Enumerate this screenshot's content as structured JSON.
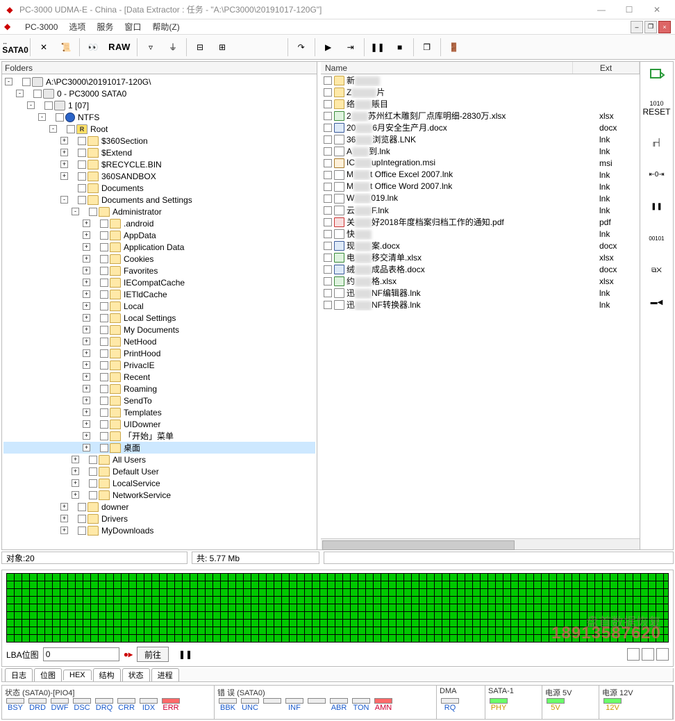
{
  "window": {
    "title": "PC-3000 UDMA-E - China - [Data Extractor : 任务 - \"A:\\PC3000\\20191017-120G\"]"
  },
  "menu": {
    "app": "PC-3000",
    "items": [
      "选项",
      "服务",
      "窗口",
      "帮助(Z)"
    ]
  },
  "toolbar": {
    "sata": "SATA0",
    "raw": "RAW"
  },
  "folders_header": "Folders",
  "tree": [
    {
      "d": 0,
      "exp": "-",
      "cb": false,
      "ico": "drive",
      "label": "A:\\PC3000\\20191017-120G\\"
    },
    {
      "d": 1,
      "exp": "-",
      "cb": true,
      "ico": "drive",
      "label": "0 - PC3000 SATA0"
    },
    {
      "d": 2,
      "exp": "-",
      "cb": true,
      "ico": "drive",
      "label": "1 [07]"
    },
    {
      "d": 3,
      "exp": "-",
      "cb": true,
      "ico": "ntfs",
      "label": "NTFS"
    },
    {
      "d": 4,
      "exp": "-",
      "cb": true,
      "ico": "root",
      "label": "Root",
      "rootText": "R"
    },
    {
      "d": 5,
      "exp": "+",
      "cb": true,
      "ico": "folder",
      "label": "$360Section"
    },
    {
      "d": 5,
      "exp": "+",
      "cb": true,
      "ico": "folder",
      "label": "$Extend"
    },
    {
      "d": 5,
      "exp": "+",
      "cb": true,
      "ico": "folder",
      "label": "$RECYCLE.BIN"
    },
    {
      "d": 5,
      "exp": "+",
      "cb": true,
      "ico": "folder",
      "label": "360SANDBOX"
    },
    {
      "d": 5,
      "exp": "",
      "cb": true,
      "ico": "folder",
      "label": "Documents"
    },
    {
      "d": 5,
      "exp": "-",
      "cb": true,
      "ico": "folder",
      "label": "Documents and Settings"
    },
    {
      "d": 6,
      "exp": "-",
      "cb": true,
      "ico": "folder",
      "label": "Administrator"
    },
    {
      "d": 7,
      "exp": "+",
      "cb": true,
      "ico": "folder",
      "label": ".android"
    },
    {
      "d": 7,
      "exp": "+",
      "cb": true,
      "ico": "folder",
      "label": "AppData"
    },
    {
      "d": 7,
      "exp": "+",
      "cb": true,
      "ico": "folder",
      "label": "Application Data"
    },
    {
      "d": 7,
      "exp": "+",
      "cb": true,
      "ico": "folder",
      "label": "Cookies"
    },
    {
      "d": 7,
      "exp": "+",
      "cb": true,
      "ico": "folder",
      "label": "Favorites"
    },
    {
      "d": 7,
      "exp": "+",
      "cb": true,
      "ico": "folder",
      "label": "IECompatCache"
    },
    {
      "d": 7,
      "exp": "+",
      "cb": true,
      "ico": "folder",
      "label": "IETldCache"
    },
    {
      "d": 7,
      "exp": "+",
      "cb": true,
      "ico": "folder",
      "label": "Local"
    },
    {
      "d": 7,
      "exp": "+",
      "cb": true,
      "ico": "folder",
      "label": "Local Settings"
    },
    {
      "d": 7,
      "exp": "+",
      "cb": true,
      "ico": "folder",
      "label": "My Documents"
    },
    {
      "d": 7,
      "exp": "+",
      "cb": true,
      "ico": "folder",
      "label": "NetHood"
    },
    {
      "d": 7,
      "exp": "+",
      "cb": true,
      "ico": "folder",
      "label": "PrintHood"
    },
    {
      "d": 7,
      "exp": "+",
      "cb": true,
      "ico": "folder",
      "label": "PrivacIE"
    },
    {
      "d": 7,
      "exp": "+",
      "cb": true,
      "ico": "folder",
      "label": "Recent"
    },
    {
      "d": 7,
      "exp": "+",
      "cb": true,
      "ico": "folder",
      "label": "Roaming"
    },
    {
      "d": 7,
      "exp": "+",
      "cb": true,
      "ico": "folder",
      "label": "SendTo"
    },
    {
      "d": 7,
      "exp": "+",
      "cb": true,
      "ico": "folder",
      "label": "Templates"
    },
    {
      "d": 7,
      "exp": "+",
      "cb": true,
      "ico": "folder",
      "label": "UIDowner"
    },
    {
      "d": 7,
      "exp": "+",
      "cb": true,
      "ico": "folder",
      "label": "「开始」菜单"
    },
    {
      "d": 7,
      "exp": "+",
      "cb": true,
      "ico": "folder",
      "label": "桌面",
      "selected": true
    },
    {
      "d": 6,
      "exp": "+",
      "cb": true,
      "ico": "folder",
      "label": "All Users"
    },
    {
      "d": 6,
      "exp": "+",
      "cb": true,
      "ico": "folder",
      "label": "Default User"
    },
    {
      "d": 6,
      "exp": "+",
      "cb": true,
      "ico": "folder",
      "label": "LocalService"
    },
    {
      "d": 6,
      "exp": "+",
      "cb": true,
      "ico": "folder",
      "label": "NetworkService"
    },
    {
      "d": 5,
      "exp": "+",
      "cb": true,
      "ico": "folder",
      "label": "downer"
    },
    {
      "d": 5,
      "exp": "+",
      "cb": true,
      "ico": "folder",
      "label": "Drivers"
    },
    {
      "d": 5,
      "exp": "+",
      "cb": true,
      "ico": "folder",
      "label": "MyDownloads"
    }
  ],
  "files_header": {
    "name": "Name",
    "ext": "Ext"
  },
  "files": [
    {
      "ico": "folder",
      "pre": "新",
      "blur": "xxxxxx",
      "post": "",
      "ext": ""
    },
    {
      "ico": "folder",
      "pre": "Z",
      "blur": "xxxxxx",
      "post": "片",
      "ext": ""
    },
    {
      "ico": "folder",
      "pre": "络",
      "blur": "xxxx",
      "post": "賬目",
      "ext": ""
    },
    {
      "ico": "xlsx",
      "pre": "2",
      "blur": "xxxx",
      "post": "苏州红木雕刻厂点库明细-2830万.xlsx",
      "ext": "xlsx"
    },
    {
      "ico": "docx",
      "pre": "20",
      "blur": "xxxx",
      "post": "6月安全生产月.docx",
      "ext": "docx"
    },
    {
      "ico": "lnk",
      "pre": "36",
      "blur": "xxxx",
      "post": "浏览器.LNK",
      "ext": "lnk"
    },
    {
      "ico": "lnk",
      "pre": "A",
      "blur": "xxxx",
      "post": "到.lnk",
      "ext": "lnk"
    },
    {
      "ico": "msi",
      "pre": "IC",
      "blur": "xxxx",
      "post": "upIntegration.msi",
      "ext": "msi"
    },
    {
      "ico": "lnk",
      "pre": "M",
      "blur": "xxxx",
      "post": "t Office Excel 2007.lnk",
      "ext": "lnk"
    },
    {
      "ico": "lnk",
      "pre": "M",
      "blur": "xxxx",
      "post": "t Office Word 2007.lnk",
      "ext": "lnk"
    },
    {
      "ico": "lnk",
      "pre": "W",
      "blur": "xxxx",
      "post": "019.lnk",
      "ext": "lnk"
    },
    {
      "ico": "lnk",
      "pre": "云",
      "blur": "xxxx",
      "post": "F.lnk",
      "ext": "lnk"
    },
    {
      "ico": "pdf",
      "pre": "关",
      "blur": "xxxx",
      "post": "好2018年度档案归档工作的通知.pdf",
      "ext": "pdf"
    },
    {
      "ico": "lnk",
      "pre": "快",
      "blur": "xxxx",
      "post": "",
      "ext": "lnk"
    },
    {
      "ico": "docx",
      "pre": "现",
      "blur": "xxxx",
      "post": "案.docx",
      "ext": "docx"
    },
    {
      "ico": "xlsx",
      "pre": "电",
      "blur": "xxxx",
      "post": "移交清单.xlsx",
      "ext": "xlsx"
    },
    {
      "ico": "docx",
      "pre": "绒",
      "blur": "xxxx",
      "post": "成品表格.docx",
      "ext": "docx"
    },
    {
      "ico": "xlsx",
      "pre": "约",
      "blur": "xxxx",
      "post": "格.xlsx",
      "ext": "xlsx"
    },
    {
      "ico": "lnk",
      "pre": "迅",
      "blur": "xxxx",
      "post": "NF编辑器.lnk",
      "ext": "lnk"
    },
    {
      "ico": "lnk",
      "pre": "迅",
      "blur": "xxxx",
      "post": "NF转换器.lnk",
      "ext": "lnk"
    }
  ],
  "status": {
    "objects": "对象:20",
    "total": "共:  5.77 Mb"
  },
  "sector": {
    "label": "LBA位图",
    "value": "0",
    "goto": "前往",
    "watermark_top": "盘首数据恢复",
    "watermark": "18913587620"
  },
  "tabs": [
    "日志",
    "位图",
    "HEX",
    "结构",
    "状态",
    "进程"
  ],
  "bottom": {
    "status_title": "状态 (SATA0)-[PIO4]",
    "status_leds": [
      "BSY",
      "DRD",
      "DWF",
      "DSC",
      "DRQ",
      "CRR",
      "IDX",
      "ERR"
    ],
    "error_title": "错 误 (SATA0)",
    "error_leds": [
      "BBK",
      "UNC",
      "",
      "INF",
      "",
      "ABR",
      "TON",
      "AMN"
    ],
    "dma_title": "DMA",
    "dma_led": "RQ",
    "sata_title": "SATA-1",
    "sata_led": "PHY",
    "pwr5_title": "电源 5V",
    "pwr5_led": "5V",
    "pwr12_title": "电源 12V",
    "pwr12_led": "12V"
  },
  "sidebar": {
    "reset": "RESET"
  }
}
